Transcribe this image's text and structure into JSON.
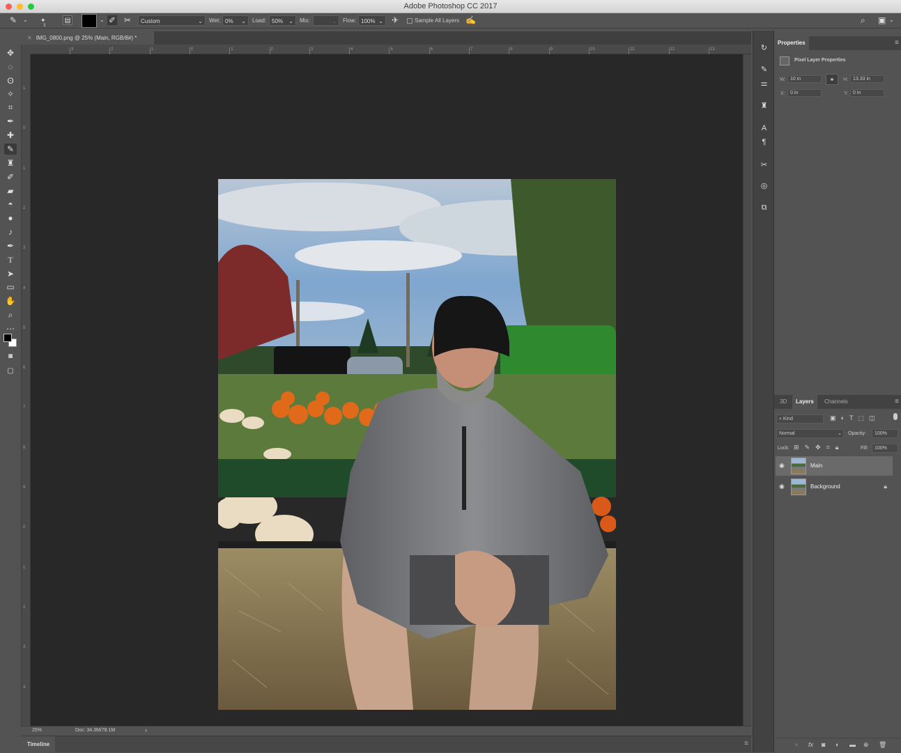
{
  "window": {
    "title": "Adobe Photoshop CC 2017"
  },
  "options_bar": {
    "brush_size": "3",
    "mix_preset": "Custom",
    "wet_label": "Wet:",
    "wet_value": "0%",
    "load_label": "Load:",
    "load_value": "50%",
    "mix_label": "Mix:",
    "mix_value": "",
    "flow_label": "Flow:",
    "flow_value": "100%",
    "sample_all_layers": "Sample All Layers"
  },
  "document": {
    "tab_title": "IMG_0800.png @ 25% (Main, RGB/8#) *"
  },
  "rulers": {
    "h": [
      "3",
      "2",
      "1",
      "0",
      "1",
      "2",
      "3",
      "4",
      "5",
      "6",
      "7",
      "8",
      "9",
      "10",
      "11",
      "12",
      "13"
    ],
    "v": [
      "1",
      "0",
      "1",
      "2",
      "3",
      "4",
      "5",
      "6",
      "7",
      "8",
      "9",
      "0",
      "1",
      "2",
      "3",
      "4"
    ]
  },
  "status": {
    "zoom": "25%",
    "doc_size": "Doc: 34.3M/78.1M",
    "arrow": "›"
  },
  "timeline": {
    "label": "Timeline"
  },
  "properties": {
    "tab": "Properties",
    "subtitle": "Pixel Layer Properties",
    "w_label": "W:",
    "w_value": "10 in",
    "h_label": "H:",
    "h_value": "13.33 in",
    "x_label": "X:",
    "x_value": "0 in",
    "y_label": "Y:",
    "y_value": "0 in"
  },
  "layers_panel": {
    "tabs": [
      "3D",
      "Layers",
      "Channels"
    ],
    "filter_kind": "Kind",
    "blend_mode": "Normal",
    "opacity_label": "Opacity:",
    "opacity_value": "100%",
    "lock_label": "Lock:",
    "fill_label": "Fill:",
    "fill_value": "100%",
    "layers": [
      {
        "name": "Main",
        "selected": true,
        "locked": false
      },
      {
        "name": "Background",
        "selected": false,
        "locked": true
      }
    ]
  },
  "colors": {
    "foreground": "#000000",
    "background": "#ffffff",
    "ui_dark": "#282828",
    "ui_panel": "#535353"
  }
}
